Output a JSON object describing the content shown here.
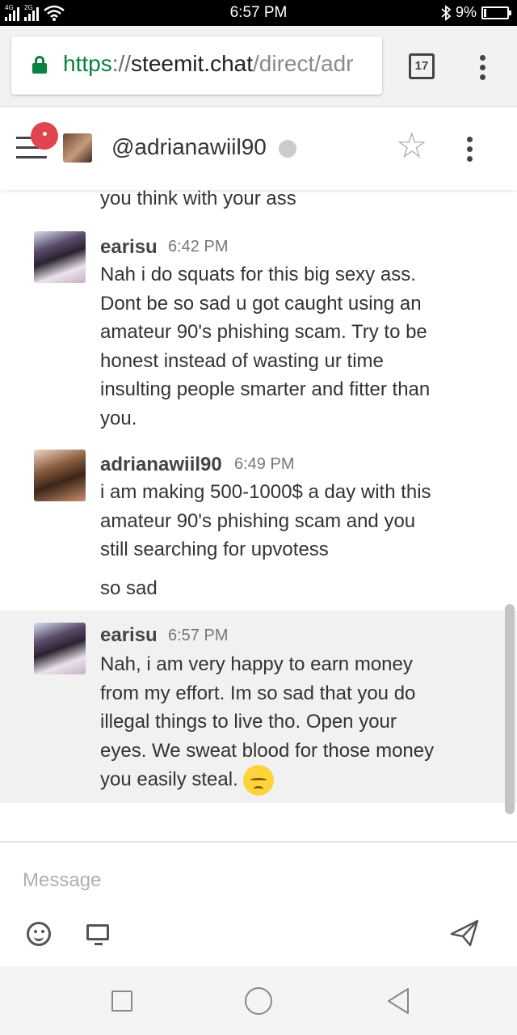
{
  "status_bar": {
    "network_1": "4G",
    "network_2": "2G",
    "time": "6:57 PM",
    "battery": "9%",
    "battery_level": 0.09
  },
  "browser": {
    "url_scheme": "https",
    "url_separator": "://",
    "url_host": "steemit.chat",
    "url_path": "/direct/adr",
    "tab_count": "17"
  },
  "chat_header": {
    "username": "@adrianawiil90",
    "status": "offline",
    "icons": [
      "menu-icon",
      "notification-badge",
      "star-icon",
      "more-vertical-icon"
    ]
  },
  "messages": [
    {
      "author": "",
      "time": "",
      "text": "you think with your ass"
    },
    {
      "author": "earisu",
      "time": "6:42 PM",
      "text": "Nah i do squats for this big sexy ass. Dont be so sad u got caught using an amateur 90's phishing scam. Try to be honest instead of wasting ur time insulting people smarter and fitter than you."
    },
    {
      "author": "adrianawiil90",
      "time": "6:49 PM",
      "text": "i am making 500-1000$ a day with this amateur 90's phishing scam and you still searching for upvotess",
      "followup": "so sad"
    },
    {
      "author": "earisu",
      "time": "6:57 PM",
      "text": "Nah, i am very happy to earn money from my effort. Im so sad that you do illegal things to live tho. Open your eyes. We sweat blood for those money you easily steal.",
      "emoji": "disappointed-face"
    }
  ],
  "composer": {
    "placeholder": "Message",
    "icons": [
      "emoji-icon",
      "screen-share-icon",
      "send-icon"
    ]
  },
  "nav_bar": {
    "icons": [
      "recents-icon",
      "home-icon",
      "back-icon"
    ]
  },
  "colors": {
    "secure_green": "#0b8043",
    "badge_red": "#e0454f",
    "highlight_row": "#f1f1f1",
    "emoji_yellow": "#ffd43b"
  }
}
